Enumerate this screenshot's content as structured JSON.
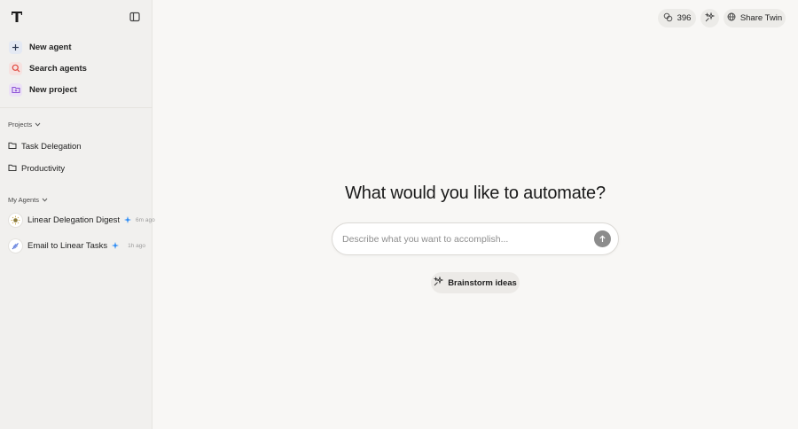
{
  "sidebar": {
    "nav": [
      {
        "label": "New agent",
        "icon": "plus-icon"
      },
      {
        "label": "Search agents",
        "icon": "search-icon"
      },
      {
        "label": "New project",
        "icon": "folder-plus-icon"
      }
    ],
    "projects_label": "Projects",
    "projects": [
      {
        "label": "Task Delegation",
        "icon": "folder-icon"
      },
      {
        "label": "Productivity",
        "icon": "folder-icon"
      }
    ],
    "agents_label": "My Agents",
    "agents": [
      {
        "name": "Linear Delegation Digest",
        "time": "6m ago",
        "icon": "sun-avatar-icon"
      },
      {
        "name": "Email to Linear Tasks",
        "time": "1h ago",
        "icon": "feather-avatar-icon"
      }
    ]
  },
  "topbar": {
    "credits": "396",
    "share_label": "Share Twin"
  },
  "main": {
    "headline": "What would you like to automate?",
    "prompt_placeholder": "Describe what you want to accomplish...",
    "prompt_value": "",
    "brainstorm_label": "Brainstorm ideas"
  },
  "colors": {
    "sidebar_bg": "#f1f0ee",
    "main_bg": "#f8f7f5",
    "accent_blue": "#2f8df5",
    "search_red": "#e0483e",
    "project_purple": "#8b4fd6"
  }
}
